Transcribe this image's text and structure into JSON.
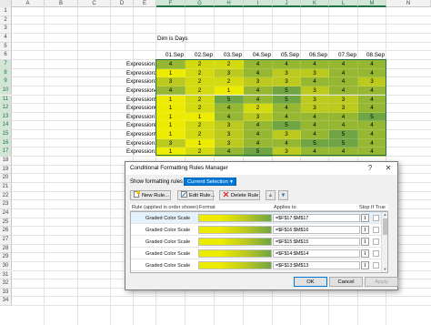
{
  "sheet": {
    "columns": [
      "A",
      "B",
      "C",
      "D",
      "E",
      "F",
      "G",
      "H",
      "I",
      "J",
      "K",
      "L",
      "M",
      "N"
    ],
    "rows": [
      "1",
      "2",
      "3",
      "4",
      "5",
      "6",
      "7",
      "8",
      "9",
      "10",
      "11",
      "12",
      "13",
      "14",
      "15",
      "16",
      "17",
      "18",
      "19",
      "20",
      "21",
      "22",
      "23",
      "24",
      "25",
      "26",
      "27",
      "28",
      "29",
      "30",
      "31",
      "32",
      "33",
      "34"
    ],
    "title_cell": "Dim is Days",
    "dates": [
      "01.Sep",
      "02.Sep",
      "03.Sep",
      "04.Sep",
      "05.Sep",
      "06.Sep",
      "07.Sep",
      "08.Sep"
    ],
    "expressions": [
      "Expression1",
      "Expression2",
      "Expression3",
      "Expression4",
      "Expression5",
      "Expression6",
      "Expression7",
      "Expression8",
      "Expression9",
      "Expression10",
      "Expression11"
    ],
    "values": [
      [
        "4",
        "2",
        "2",
        "4",
        "4",
        "4",
        "4",
        "4"
      ],
      [
        "1",
        "2",
        "3",
        "4",
        "3",
        "3",
        "4",
        "4"
      ],
      [
        "3",
        "2",
        "2",
        "3",
        "3",
        "4",
        "4",
        "3"
      ],
      [
        "4",
        "2",
        "1",
        "4",
        "5",
        "3",
        "4",
        "4"
      ],
      [
        "1",
        "2",
        "5",
        "4",
        "5",
        "3",
        "3",
        "4"
      ],
      [
        "1",
        "2",
        "4",
        "2",
        "4",
        "3",
        "3",
        "4"
      ],
      [
        "1",
        "1",
        "4",
        "3",
        "4",
        "4",
        "4",
        "5"
      ],
      [
        "1",
        "2",
        "3",
        "4",
        "5",
        "4",
        "4",
        "4"
      ],
      [
        "1",
        "2",
        "3",
        "4",
        "3",
        "4",
        "5",
        "4"
      ],
      [
        "3",
        "1",
        "3",
        "4",
        "4",
        "5",
        "5",
        "4"
      ],
      [
        "1",
        "2",
        "4",
        "5",
        "3",
        "4",
        "4",
        "4"
      ]
    ],
    "colors": {
      "low": "#eceb00",
      "mid": "#bcc91f",
      "high": "#6fa542",
      "selection": "#217346"
    }
  },
  "dialog": {
    "title": "Conditional Formatting Rules Manager",
    "help_label": "?",
    "close_label": "✕",
    "show_label": "Show formatting rules for:",
    "show_value": "Current Selection",
    "new_rule_label": "New Rule...",
    "edit_rule_label": "Edit Rule...",
    "delete_rule_label": "Delete Rule",
    "up_icon": "up-arrow-icon",
    "down_icon": "down-arrow-icon",
    "col_rule": "Rule (applied in order shown)",
    "col_format": "Format",
    "col_applies": "Applies to",
    "col_stop": "Stop If True",
    "rules": [
      {
        "name": "Graded Color Scale",
        "applies": "=$F$17:$M$17"
      },
      {
        "name": "Graded Color Scale",
        "applies": "=$F$16:$M$16"
      },
      {
        "name": "Graded Color Scale",
        "applies": "=$F$15:$M$15"
      },
      {
        "name": "Graded Color Scale",
        "applies": "=$F$14:$M$14"
      },
      {
        "name": "Graded Color Scale",
        "applies": "=$F$13:$M$13"
      }
    ],
    "collapse_glyph": "⭱",
    "ok_label": "OK",
    "cancel_label": "Cancel",
    "apply_label": "Apply"
  }
}
